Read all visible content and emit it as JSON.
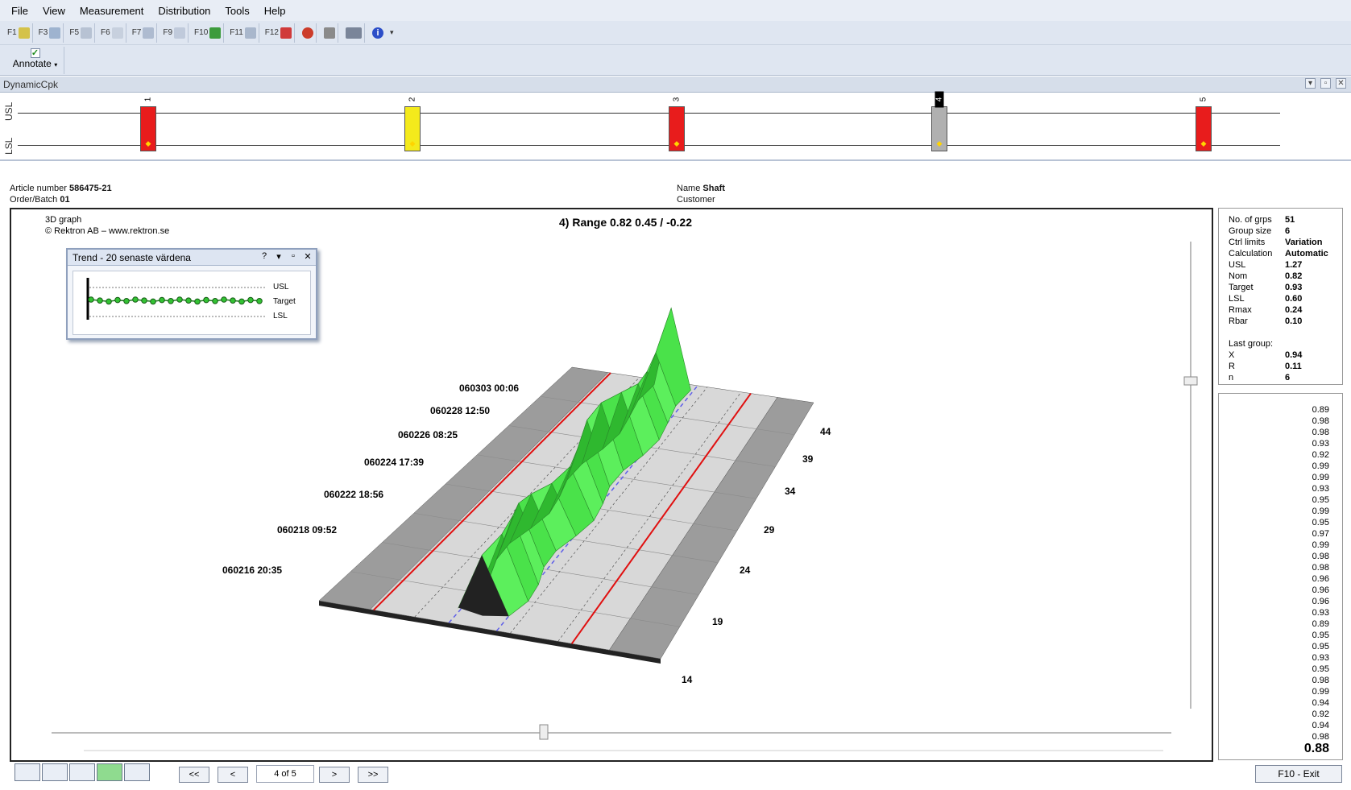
{
  "menu": [
    "File",
    "View",
    "Measurement",
    "Distribution",
    "Tools",
    "Help"
  ],
  "toolbar": {
    "items": [
      "F1",
      "F3",
      "F5",
      "F6",
      "F7",
      "F9",
      "F10",
      "F11",
      "F12"
    ],
    "annotate_label": "Annotate"
  },
  "dynamic": {
    "title": "DynamicCpk",
    "usl_label": "USL",
    "lsl_label": "LSL",
    "bars": [
      {
        "num": "1",
        "color": "#e81c1c"
      },
      {
        "num": "2",
        "color": "#f4ea1c"
      },
      {
        "num": "3",
        "color": "#e81c1c"
      },
      {
        "num": "4",
        "color": "#b0b0b0"
      },
      {
        "num": "5",
        "color": "#e81c1c"
      }
    ]
  },
  "header": {
    "article_label": "Article number",
    "article_value": "586475-21",
    "order_label": "Order/Batch",
    "order_value": "01",
    "name_label": "Name",
    "name_value": "Shaft",
    "customer_label": "Customer"
  },
  "graph": {
    "type_label": "3D graph",
    "copyright": "© Rektron AB – www.rektron.se",
    "title": "4) Range  0.82  0.45 / -0.22",
    "dates": [
      "060303 00:06",
      "060228 12:50",
      "060226 08:25",
      "060224 17:39",
      "060222 18:56",
      "060218 09:52",
      "060216 20:35"
    ],
    "ticks": [
      "44",
      "39",
      "34",
      "29",
      "24",
      "19",
      "14"
    ]
  },
  "trend": {
    "title": "Trend - 20 senaste värdena",
    "help": "?",
    "usl": "USL",
    "target": "Target",
    "lsl": "LSL"
  },
  "stats": {
    "rows": [
      {
        "k": "No. of grps",
        "v": "51"
      },
      {
        "k": "Group size",
        "v": "6"
      },
      {
        "k": "Ctrl limits",
        "v": "Variation"
      },
      {
        "k": "Calculation",
        "v": "Automatic"
      },
      {
        "k": "USL",
        "v": "1.27"
      },
      {
        "k": "Nom",
        "v": "0.82"
      },
      {
        "k": "Target",
        "v": "0.93"
      },
      {
        "k": "LSL",
        "v": "0.60"
      },
      {
        "k": "Rmax",
        "v": "0.24"
      },
      {
        "k": "Rbar",
        "v": "0.10"
      }
    ],
    "last_group_label": "Last group:",
    "last": [
      {
        "k": "X",
        "v": "0.94"
      },
      {
        "k": "R",
        "v": "0.11"
      },
      {
        "k": "n",
        "v": "6"
      }
    ]
  },
  "values": [
    "0.89",
    "0.98",
    "0.98",
    "0.93",
    "0.92",
    "0.99",
    "0.99",
    "0.93",
    "0.95",
    "0.99",
    "0.95",
    "0.97",
    "0.99",
    "0.98",
    "0.98",
    "0.96",
    "0.96",
    "0.96",
    "0.93",
    "0.89",
    "0.95",
    "0.95",
    "0.93",
    "0.95",
    "0.98",
    "0.99",
    "0.94",
    "0.92",
    "0.94",
    "0.98"
  ],
  "last_value": "0.88",
  "footer": {
    "first": "<<",
    "prev": "<",
    "page": "4 of 5",
    "next": ">",
    "last": ">>",
    "exit": "F10 - Exit"
  },
  "colors": {
    "usl_line": "#e01010",
    "target_line": "#6060e8",
    "surface": "#3ed93e"
  }
}
